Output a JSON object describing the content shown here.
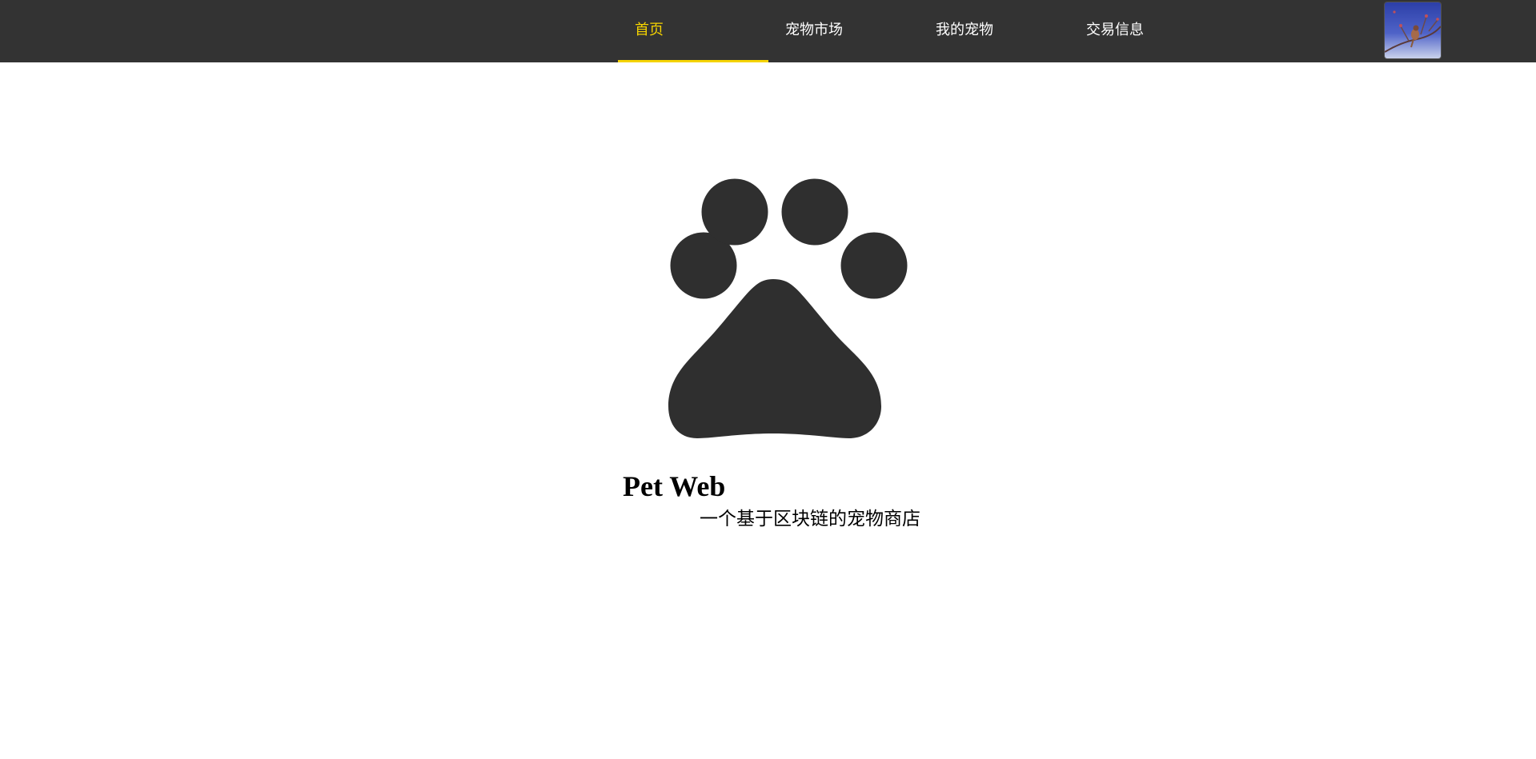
{
  "nav": {
    "items": [
      {
        "label": "首页",
        "active": true
      },
      {
        "label": "宠物市场",
        "active": false
      },
      {
        "label": "我的宠物",
        "active": false
      },
      {
        "label": "交易信息",
        "active": false
      }
    ],
    "active_color": "#f5d300",
    "background_color": "#333333"
  },
  "user": {
    "avatar_icon": "bird-on-branch-photo"
  },
  "hero": {
    "logo_icon": "paw-print-icon",
    "logo_color": "#2f2f2f",
    "title": "Pet Web",
    "subtitle": "一个基于区块链的宠物商店"
  }
}
